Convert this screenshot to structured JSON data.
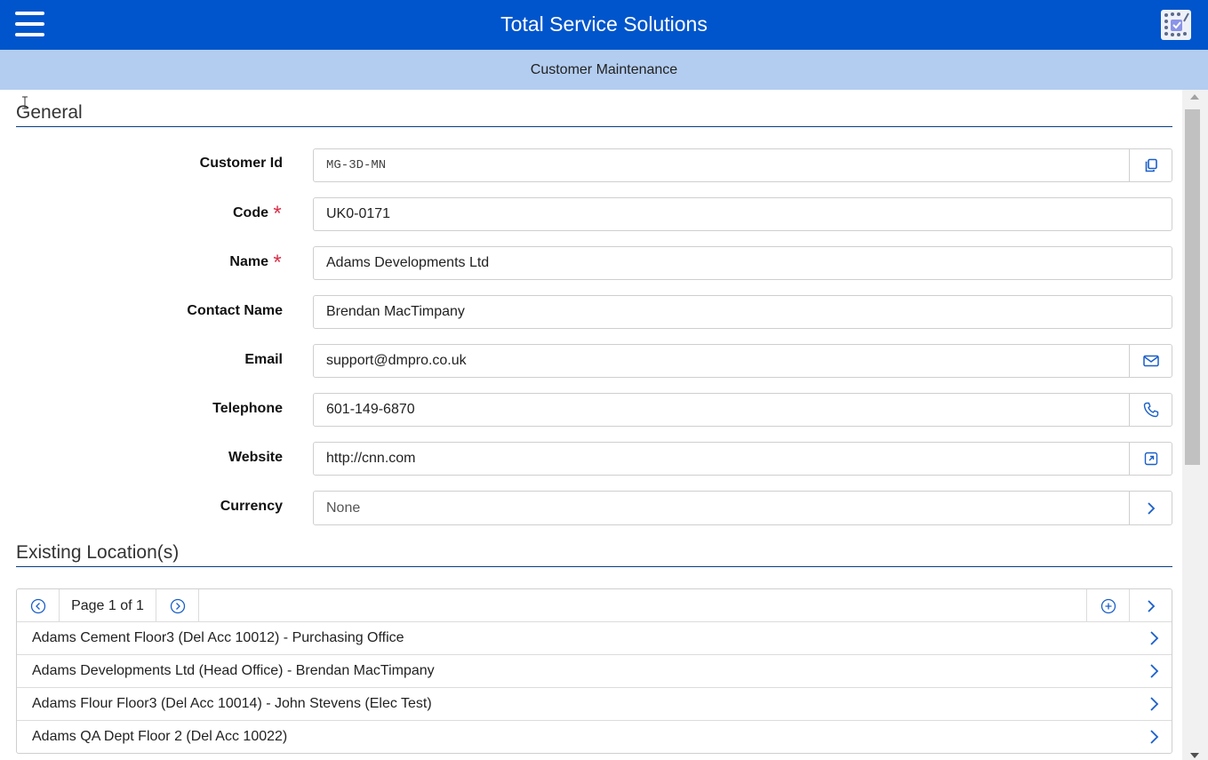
{
  "header": {
    "title": "Total Service Solutions",
    "menu_icon": "hamburger-menu-icon",
    "logo_icon": "app-logo-icon"
  },
  "subheader": {
    "title": "Customer Maintenance"
  },
  "colors": {
    "header_bg": "#0055cc",
    "subheader_bg": "#b3cdf0",
    "accent": "#1a5fc9",
    "required": "#d8304a",
    "section_rule": "#0b3d7e"
  },
  "general": {
    "section_title": "General",
    "fields": {
      "customer_id": {
        "label": "Customer Id",
        "value": "MG-3D-MN",
        "action_icon": "copy-icon"
      },
      "code": {
        "label": "Code",
        "value": "UK0-0171",
        "required_mark": "*"
      },
      "name": {
        "label": "Name",
        "value": "Adams Developments Ltd",
        "required_mark": "*"
      },
      "contact_name": {
        "label": "Contact Name",
        "value": "Brendan MacTimpany"
      },
      "email": {
        "label": "Email",
        "value": "support@dmpro.co.uk",
        "action_icon": "mail-icon"
      },
      "telephone": {
        "label": "Telephone",
        "value": "601-149-6870",
        "action_icon": "phone-icon"
      },
      "website": {
        "label": "Website",
        "value": "http://cnn.com",
        "action_icon": "external-link-icon"
      },
      "currency": {
        "label": "Currency",
        "value": "None",
        "action_icon": "chevron-right-icon"
      }
    }
  },
  "locations": {
    "section_title": "Existing Location(s)",
    "pager": {
      "page_text": "Page 1 of 1"
    },
    "rows": [
      {
        "text": "Adams Cement Floor3 (Del Acc 10012) - Purchasing Office"
      },
      {
        "text": "Adams Developments Ltd (Head Office) - Brendan MacTimpany"
      },
      {
        "text": "Adams Flour Floor3 (Del Acc 10014) - John Stevens (Elec Test)"
      },
      {
        "text": "Adams QA Dept Floor 2 (Del Acc 10022)"
      }
    ]
  }
}
